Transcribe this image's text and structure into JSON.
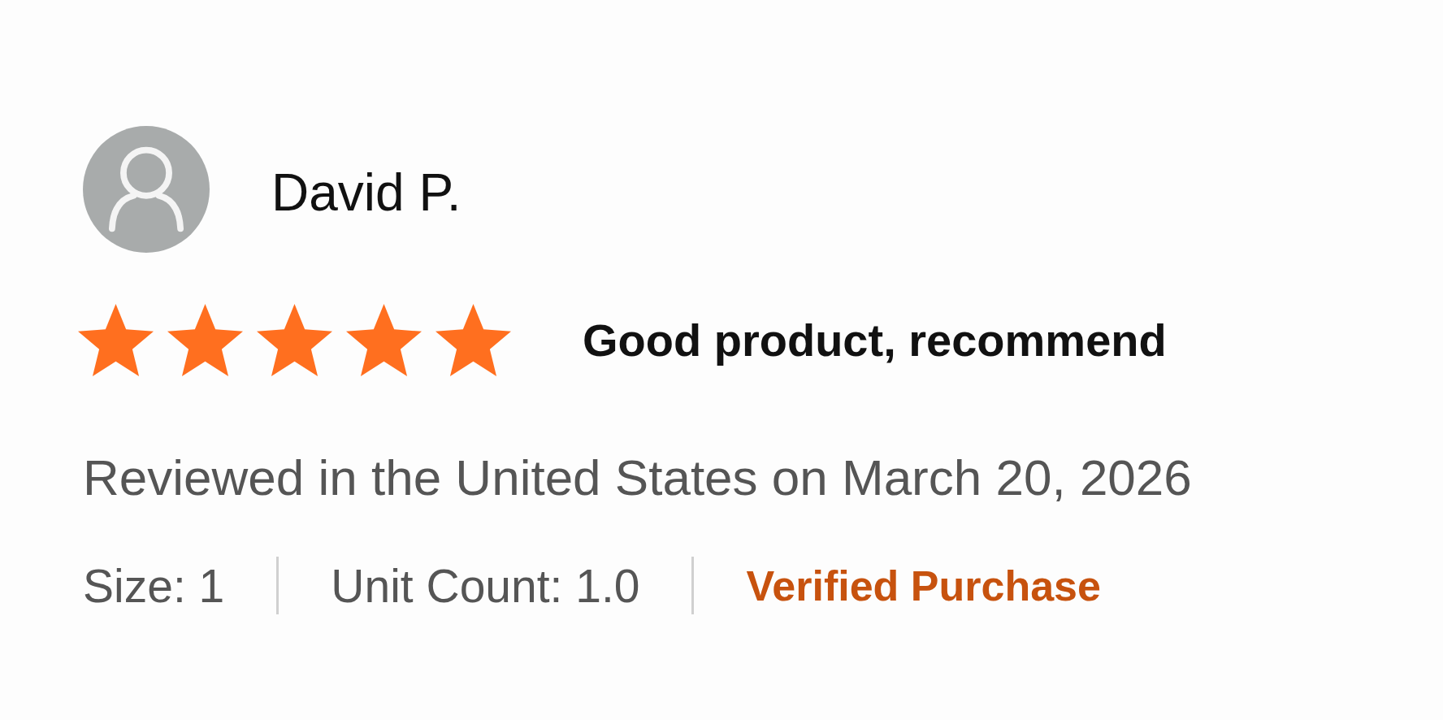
{
  "reviewer": {
    "name": "David P."
  },
  "review": {
    "stars": 5,
    "title": "Good product, recommend",
    "date_line": "Reviewed in the United States on March 20, 2026",
    "details": [
      "Size: 1",
      "Unit Count: 1.0"
    ],
    "badge": "Verified Purchase"
  }
}
